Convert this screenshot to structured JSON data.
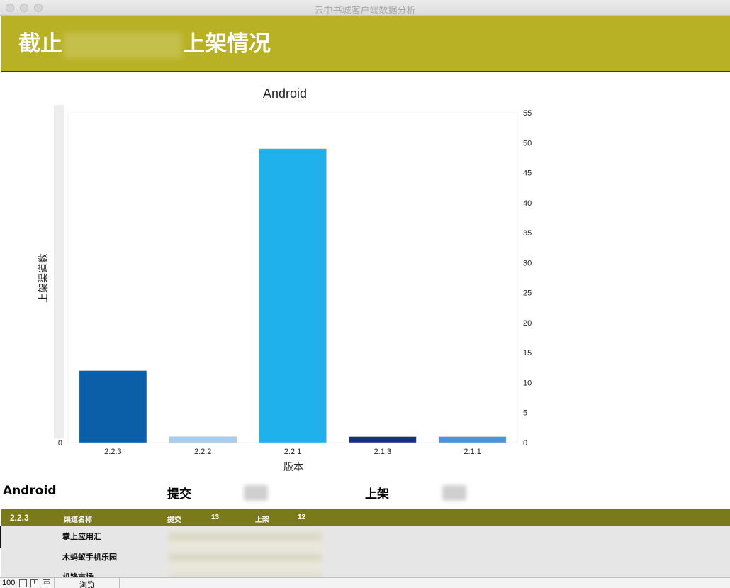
{
  "window": {
    "title": "云中书城客户端数据分析"
  },
  "banner": {
    "title_prefix": "截止",
    "title_suffix": "上架情况"
  },
  "chart_data": {
    "type": "bar",
    "title": "Android",
    "xlabel": "版本",
    "ylabel": "上架渠道数",
    "categories": [
      "2.2.3",
      "2.2.2",
      "2.2.1",
      "2.1.3",
      "2.1.1"
    ],
    "values": [
      12,
      1,
      49,
      1,
      1
    ],
    "colors": [
      "#0b5ea8",
      "#a7cdee",
      "#1fb1ec",
      "#18317e",
      "#4a93d6"
    ],
    "ylim": [
      0,
      55
    ],
    "yticks": [
      0,
      5,
      10,
      15,
      20,
      25,
      30,
      35,
      40,
      45,
      50,
      55
    ],
    "y_axis_position": "right",
    "grid": false
  },
  "summary": {
    "platform": "Android",
    "submit_label": "提交",
    "listed_label": "上架"
  },
  "table": {
    "header": {
      "version": "2.2.3",
      "channel_label": "渠道名称",
      "submit_label": "提交",
      "submit_value": "13",
      "listed_label": "上架",
      "listed_value": "12"
    },
    "rows": [
      "掌上应用汇",
      "木蚂蚁手机乐园",
      "机锋市场"
    ]
  },
  "statusbar": {
    "zoom": "100",
    "mode": "浏览"
  }
}
